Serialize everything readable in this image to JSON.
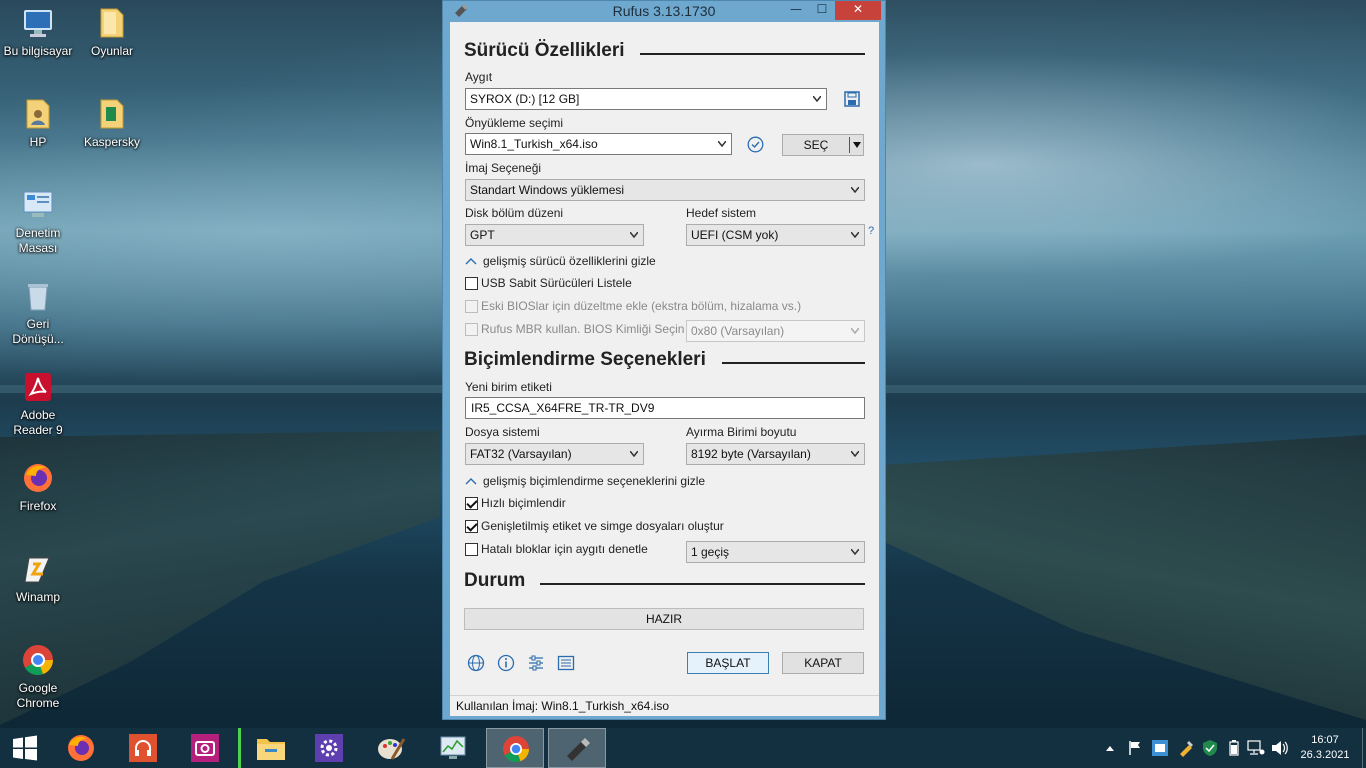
{
  "desktop": {
    "icons": [
      {
        "label": "Bu bilgisayar"
      },
      {
        "label": "Oyunlar"
      },
      {
        "label": "HP"
      },
      {
        "label": "Kaspersky"
      },
      {
        "label": "Denetim Masası"
      },
      {
        "label": "Geri Dönüşü..."
      },
      {
        "label": "Adobe Reader 9"
      },
      {
        "label": "Firefox"
      },
      {
        "label": "Winamp"
      },
      {
        "label": "Google Chrome"
      }
    ]
  },
  "window": {
    "title": "Rufus 3.13.1730",
    "minimize": "—",
    "maximize": "☐",
    "close": "✕"
  },
  "drive": {
    "section_title": "Sürücü Özellikleri",
    "device_label": "Aygıt",
    "device_value": "SYROX (D:) [12 GB]",
    "boot_label": "Önyükleme seçimi",
    "boot_value": "Win8.1_Turkish_x64.iso",
    "select_button": "SEÇ",
    "image_option_label": "İmaj Seçeneği",
    "image_option_value": "Standart Windows yüklemesi",
    "partition_label": "Disk bölüm düzeni",
    "partition_value": "GPT",
    "target_label": "Hedef sistem",
    "target_value": "UEFI (CSM yok)",
    "help_mark": "?",
    "advanced_toggle": "gelişmiş sürücü özelliklerini gizle",
    "usb_hdd_label": "USB Sabit Sürücüleri Listele",
    "old_bios_label": "Eski BIOSlar için düzeltme ekle (ekstra bölüm, hizalama vs.)",
    "rufus_mbr_label": "Rufus MBR kullan. BIOS Kimliği Seçin",
    "bios_id_value": "0x80 (Varsayılan)"
  },
  "format": {
    "section_title": "Biçimlendirme Seçenekleri",
    "volume_label": "Yeni birim etiketi",
    "volume_value": "IR5_CCSA_X64FRE_TR-TR_DV9",
    "fs_label": "Dosya sistemi",
    "fs_value": "FAT32 (Varsayılan)",
    "cluster_label": "Ayırma Birimi boyutu",
    "cluster_value": "8192 byte (Varsayılan)",
    "advanced_toggle": "gelişmiş biçimlendirme seçeneklerini gizle",
    "quick_format_label": "Hızlı biçimlendir",
    "extended_label": "Genişletilmiş etiket ve simge dosyaları oluştur",
    "bad_blocks_label": "Hatalı bloklar için aygıtı denetle",
    "passes_value": "1 geçiş"
  },
  "status": {
    "section_title": "Durum",
    "status_text": "HAZIR",
    "start_button": "BAŞLAT",
    "close_button": "KAPAT",
    "footer_text": "Kullanılan İmaj: Win8.1_Turkish_x64.iso"
  },
  "tray": {
    "time": "16:07",
    "date": "26.3.2021"
  }
}
